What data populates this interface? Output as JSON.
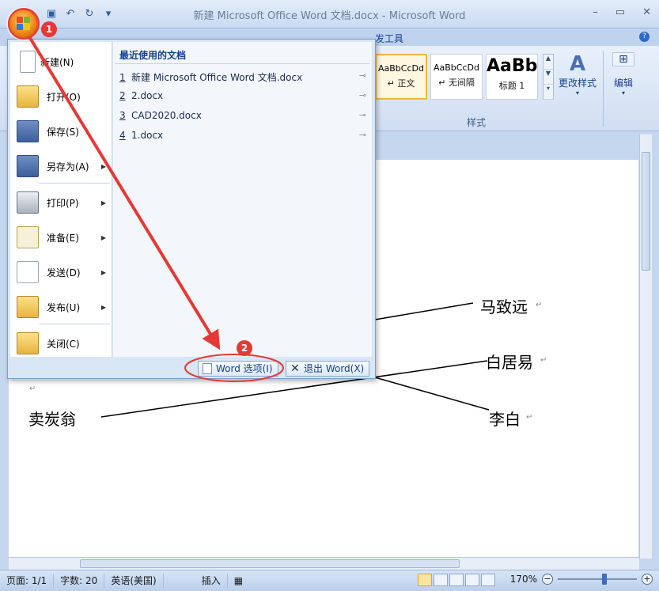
{
  "window": {
    "title": "新建 Microsoft Office Word 文档.docx - Microsoft Word",
    "controls": [
      "–",
      "▭",
      "✕"
    ]
  },
  "quick_access": [
    "save-icon",
    "undo-icon",
    "redo-icon",
    "customize-icon"
  ],
  "ribbon": {
    "visible_tab": "发工具",
    "help": "?",
    "styles": [
      {
        "sample": "AaBbCcDd",
        "name": "↵ 正文",
        "active": true
      },
      {
        "sample": "AaBbCcDd",
        "name": "↵ 无间隔",
        "active": false
      },
      {
        "sample": "AaBb",
        "name": "标题 1",
        "active": false
      }
    ],
    "change_styles": "更改样式",
    "edit": "编辑",
    "group_label": "样式"
  },
  "office_menu": {
    "left_items": [
      {
        "label": "新建(N)",
        "icon": "new-document-icon",
        "submenu": false
      },
      {
        "label": "打开(O)",
        "icon": "open-folder-icon",
        "submenu": false
      },
      {
        "label": "保存(S)",
        "icon": "save-disk-icon",
        "submenu": false
      },
      {
        "label": "另存为(A)",
        "icon": "save-as-icon",
        "submenu": true
      },
      {
        "label": "打印(P)",
        "icon": "printer-icon",
        "submenu": true
      },
      {
        "label": "准备(E)",
        "icon": "prepare-icon",
        "submenu": true
      },
      {
        "label": "发送(D)",
        "icon": "send-icon",
        "submenu": true
      },
      {
        "label": "发布(U)",
        "icon": "publish-icon",
        "submenu": true
      },
      {
        "label": "关闭(C)",
        "icon": "close-folder-icon",
        "submenu": false
      }
    ],
    "recent_title": "最近使用的文档",
    "recent_docs": [
      {
        "num": "1",
        "name": "新建 Microsoft Office Word 文档.docx"
      },
      {
        "num": "2",
        "name": "2.docx"
      },
      {
        "num": "3",
        "name": "CAD2020.docx"
      },
      {
        "num": "4",
        "name": "1.docx"
      }
    ],
    "word_options": "Word 选项(I)",
    "exit_word": "退出 Word(X)"
  },
  "document": {
    "words": {
      "w1": "马致远",
      "w2": "白居易",
      "w3": "卖炭翁",
      "w4": "李白"
    },
    "para_mark": "↵"
  },
  "statusbar": {
    "page": "页面: 1/1",
    "words": "字数: 20",
    "language": "英语(美国)",
    "mode": "插入",
    "zoom": "170%",
    "zoom_minus": "−",
    "zoom_plus": "+"
  },
  "callouts": {
    "step1": "1",
    "step2": "2"
  },
  "colors": {
    "accent_red": "#e53935",
    "ribbon_blue": "#15428b"
  }
}
